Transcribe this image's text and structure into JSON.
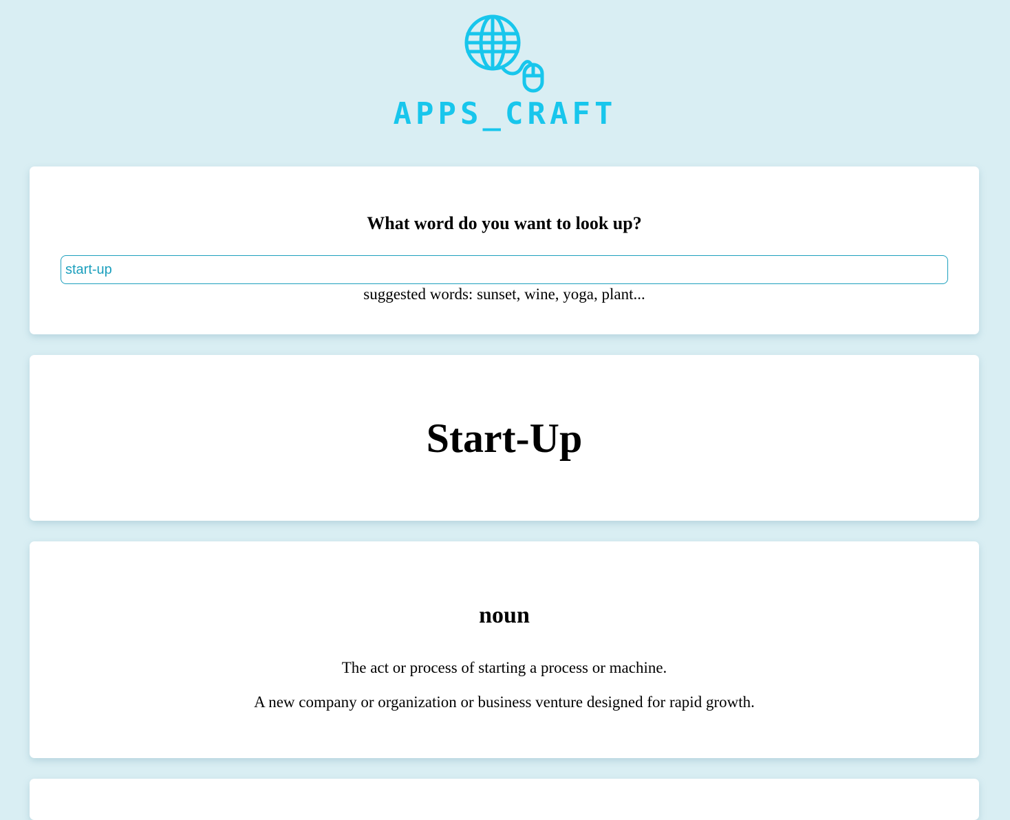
{
  "brand": {
    "name": "APPS_CRAFT",
    "icon": "globe-with-mouse-icon",
    "color": "#18c6ec"
  },
  "search": {
    "question": "What word do you want to look up?",
    "input_value": "start-up",
    "suggestions": "suggested words: sunset, wine, yoga, plant..."
  },
  "result": {
    "word": "Start-Up",
    "meanings": [
      {
        "part_of_speech": "noun",
        "definitions": [
          "The act or process of starting a process or machine.",
          "A new company or organization or business venture designed for rapid growth."
        ]
      }
    ]
  },
  "colors": {
    "background": "#d9eef3",
    "card": "#ffffff",
    "input_accent": "#1b9fbd"
  }
}
